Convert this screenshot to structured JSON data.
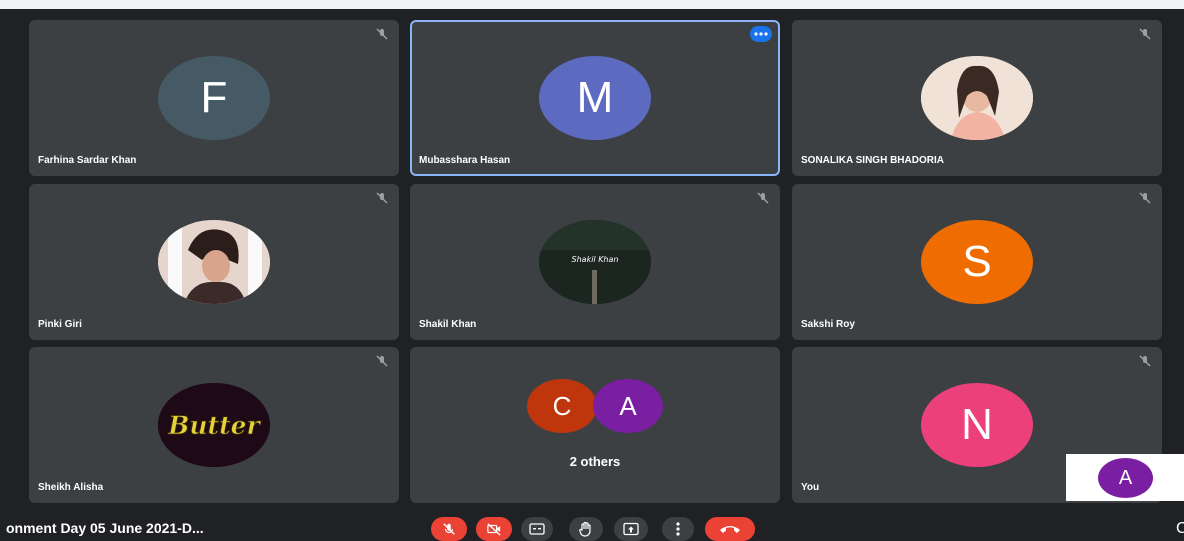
{
  "participants": [
    {
      "name": "Farhina Sardar Khan",
      "initial": "F",
      "color": "#455a64"
    },
    {
      "name": "Mubasshara Hasan",
      "initial": "M",
      "color": "#5c6bc0"
    },
    {
      "name": "SONALIKA SINGH BHADORIA",
      "photo_icon": "profile-photo"
    },
    {
      "name": "Pinki Giri",
      "photo_icon": "profile-photo"
    },
    {
      "name": "Shakil Khan",
      "photo_caption": "Shakil Khan"
    },
    {
      "name": "Sakshi Roy",
      "initial": "S",
      "color": "#ef6c00"
    },
    {
      "name": "Sheikh Alisha",
      "photo_caption": "Butter"
    },
    {
      "others_label": "2 others",
      "initials": [
        "C",
        "A"
      ],
      "colors": [
        "#bf360c",
        "#7b1fa2"
      ]
    },
    {
      "name": "You",
      "initial": "N",
      "color": "#ec407a"
    }
  ],
  "self_view": {
    "initial": "A",
    "color": "#7b1fa2"
  },
  "meeting_title": "onment Day 05 June 2021-D...",
  "controls": [
    {
      "icon": "mic-off-icon"
    },
    {
      "icon": "camera-off-icon"
    },
    {
      "icon": "captions-icon"
    },
    {
      "icon": "raise-hand-icon"
    },
    {
      "icon": "present-screen-icon"
    },
    {
      "icon": "more-options-icon"
    },
    {
      "icon": "leave-call-icon"
    }
  ],
  "edge_glyph": "C",
  "colors": {
    "background": "#202124",
    "tile": "#3c4043",
    "active_border": "#8ab4f8",
    "danger": "#ea4335"
  }
}
